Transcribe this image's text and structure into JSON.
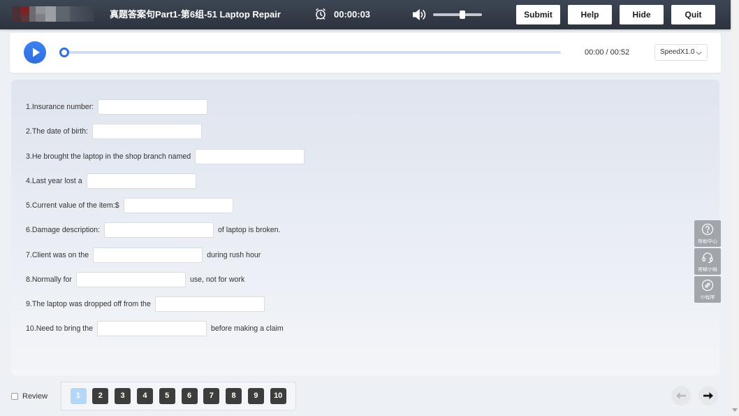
{
  "header": {
    "title": "真题答案句Part1-第6组-51 Laptop Repair",
    "timer_icon": "alarm-clock-icon",
    "timer": "00:00:03",
    "volume_icon": "speaker-icon",
    "volume_level": 0.6,
    "buttons": {
      "submit": "Submit",
      "help": "Help",
      "hide": "Hide",
      "quit": "Quit"
    }
  },
  "player": {
    "play_icon": "play-icon",
    "progress": 0,
    "current_time": "00:00",
    "time_separator": "/",
    "duration": "00:52",
    "speed": "SpeedX1.0"
  },
  "questions": [
    {
      "prefix": "1.Insurance number:",
      "answer": ""
    },
    {
      "prefix": "2.The date of birth:",
      "answer": ""
    },
    {
      "prefix": "3.He brought the laptop in the shop branch named",
      "answer": ""
    },
    {
      "prefix": "4.Last year lost a",
      "answer": ""
    },
    {
      "prefix": "5.Current value of the item:$",
      "answer": ""
    },
    {
      "prefix": "6.Damage description:",
      "answer": "",
      "suffix": "of laptop is broken."
    },
    {
      "prefix": "7.Client was on the",
      "answer": "",
      "suffix": "during rush hour"
    },
    {
      "prefix": "8.Normally for",
      "answer": "",
      "suffix": "use, not for work"
    },
    {
      "prefix": "9.The laptop was dropped off from the",
      "answer": ""
    },
    {
      "prefix": "10.Need to bring the",
      "answer": "",
      "suffix": "before making a claim"
    }
  ],
  "side_tools": [
    {
      "label": "帮助中心",
      "icon": "help-circle-icon"
    },
    {
      "label": "答疑小组",
      "icon": "headset-icon"
    },
    {
      "label": "小程序",
      "icon": "link-icon"
    }
  ],
  "footer": {
    "review_label": "Review",
    "review_checked": false,
    "pages": [
      "1",
      "2",
      "3",
      "4",
      "5",
      "6",
      "7",
      "8",
      "9",
      "10"
    ],
    "current_page": 1,
    "prev_icon": "arrow-left-icon",
    "prev_enabled": false,
    "next_icon": "arrow-right-icon"
  },
  "colors": {
    "accent": "#2f6fe0",
    "current_page": "#b3d8f7",
    "page_button": "#3d3d3d",
    "side_tool": "#a1a6ac"
  }
}
